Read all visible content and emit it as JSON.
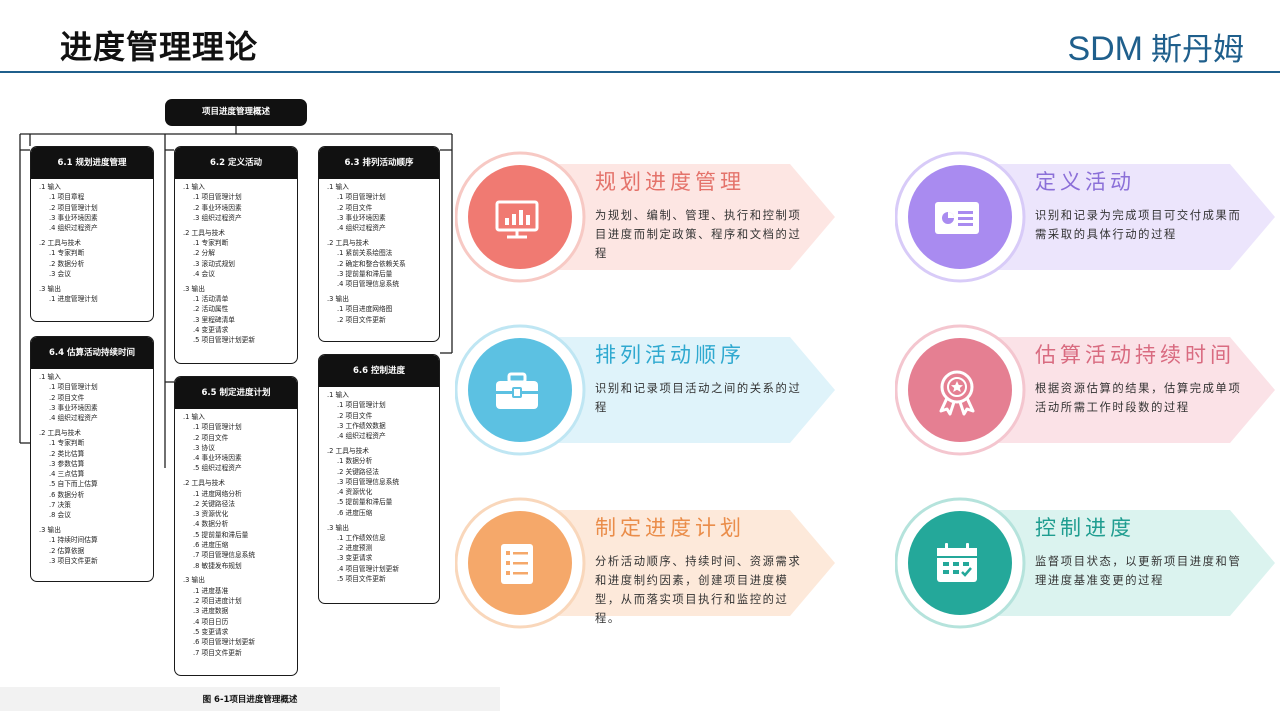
{
  "header": {
    "title": "进度管理理论",
    "brand_en": "SDM",
    "brand_cn": "斯丹姆"
  },
  "diagram": {
    "top_label": "项目进度管理概述",
    "caption": "图 6-1项目进度管理概述",
    "processes": [
      {
        "title": "6.1 规划进度管理",
        "groups": [
          {
            "heading": ".1 输入",
            "items": [
              ".1 项目章程",
              ".2 项目管理计划",
              ".3 事业环境因素",
              ".4 组织过程资产"
            ]
          },
          {
            "heading": ".2 工具与技术",
            "items": [
              ".1 专家判断",
              ".2 数据分析",
              ".3 会议"
            ]
          },
          {
            "heading": ".3 输出",
            "items": [
              ".1 进度管理计划"
            ]
          }
        ]
      },
      {
        "title": "6.2 定义活动",
        "groups": [
          {
            "heading": ".1 输入",
            "items": [
              ".1 项目管理计划",
              ".2 事业环境因素",
              ".3 组织过程资产"
            ]
          },
          {
            "heading": ".2 工具与技术",
            "items": [
              ".1 专家判断",
              ".2 分解",
              ".3 滚动式规划",
              ".4 会议"
            ]
          },
          {
            "heading": ".3 输出",
            "items": [
              ".1 活动清单",
              ".2 活动属性",
              ".3 里程碑清单",
              ".4 变更请求",
              ".5 项目管理计划更新"
            ]
          }
        ]
      },
      {
        "title": "6.3 排列活动顺序",
        "groups": [
          {
            "heading": ".1 输入",
            "items": [
              ".1 项目管理计划",
              ".2 项目文件",
              ".3 事业环境因素",
              ".4 组织过程资产"
            ]
          },
          {
            "heading": ".2 工具与技术",
            "items": [
              ".1 紧前关系绘图法",
              ".2 确定和整合依赖关系",
              ".3 提前量和滞后量",
              ".4 项目管理信息系统"
            ]
          },
          {
            "heading": ".3 输出",
            "items": [
              ".1 项目进度网络图",
              ".2 项目文件更新"
            ]
          }
        ]
      },
      {
        "title": "6.4 估算活动持续时间",
        "groups": [
          {
            "heading": ".1 输入",
            "items": [
              ".1 项目管理计划",
              ".2 项目文件",
              ".3 事业环境因素",
              ".4 组织过程资产"
            ]
          },
          {
            "heading": ".2 工具与技术",
            "items": [
              ".1 专家判断",
              ".2 类比估算",
              ".3 参数估算",
              ".4 三点估算",
              ".5 自下而上估算",
              ".6 数据分析",
              ".7 决策",
              ".8 会议"
            ]
          },
          {
            "heading": ".3 输出",
            "items": [
              ".1 持续时间估算",
              ".2 估算依据",
              ".3 项目文件更新"
            ]
          }
        ]
      },
      {
        "title": "6.5 制定进度计划",
        "groups": [
          {
            "heading": ".1 输入",
            "items": [
              ".1 项目管理计划",
              ".2 项目文件",
              ".3 协议",
              ".4 事业环境因素",
              ".5 组织过程资产"
            ]
          },
          {
            "heading": ".2 工具与技术",
            "items": [
              ".1 进度网络分析",
              ".2 关键路径法",
              ".3 资源优化",
              ".4 数据分析",
              ".5 提前量和滞后量",
              ".6 进度压缩",
              ".7 项目管理信息系统",
              ".8 敏捷发布规划"
            ]
          },
          {
            "heading": ".3 输出",
            "items": [
              ".1 进度基准",
              ".2 项目进度计划",
              ".3 进度数据",
              ".4 项目日历",
              ".5 变更请求",
              ".6 项目管理计划更新",
              ".7 项目文件更新"
            ]
          }
        ]
      },
      {
        "title": "6.6 控制进度",
        "groups": [
          {
            "heading": ".1 输入",
            "items": [
              ".1 项目管理计划",
              ".2 项目文件",
              ".3 工作绩效数据",
              ".4 组织过程资产"
            ]
          },
          {
            "heading": ".2 工具与技术",
            "items": [
              ".1 数据分析",
              ".2 关键路径法",
              ".3 项目管理信息系统",
              ".4 资源优化",
              ".5 提前量和滞后量",
              ".6 进度压缩"
            ]
          },
          {
            "heading": ".3 输出",
            "items": [
              ".1 工作绩效信息",
              ".2 进度预测",
              ".3 变更请求",
              ".4 项目管理计划更新",
              ".5 项目文件更新"
            ]
          }
        ]
      }
    ]
  },
  "cards": [
    {
      "title": "规划进度管理",
      "desc": "为规划、编制、管理、执行和控制项目进度而制定政策、程序和文档的过程",
      "icon": "chart-monitor-icon",
      "accent": "#f07a72",
      "ring": "#f7c9c4",
      "band": "#fde6e3",
      "title_color": "#e4726a"
    },
    {
      "title": "定义活动",
      "desc": "识别和记录为完成项目可交付成果而需采取的具体行动的过程",
      "icon": "id-card-icon",
      "accent": "#a98bf0",
      "ring": "#d8cbf8",
      "band": "#ece5fc",
      "title_color": "#8b6fd8"
    },
    {
      "title": "排列活动顺序",
      "desc": "识别和记录项目活动之间的关系的过程",
      "icon": "briefcase-icon",
      "accent": "#5cc1e2",
      "ring": "#bfe6f3",
      "band": "#dff3fa",
      "title_color": "#2fa9d0"
    },
    {
      "title": "估算活动持续时间",
      "desc": "根据资源估算的结果，估算完成单项活动所需工作时段数的过程",
      "icon": "award-badge-icon",
      "accent": "#e57f92",
      "ring": "#f4c6cf",
      "band": "#fbe2e7",
      "title_color": "#d96b80"
    },
    {
      "title": "制定进度计划",
      "desc": "分析活动顺序、持续时间、资源需求和进度制约因素，创建项目进度模型，从而落实项目执行和监控的过程。",
      "icon": "checklist-icon",
      "accent": "#f5a86a",
      "ring": "#f9d7bb",
      "band": "#fde9da",
      "title_color": "#ea8d4a"
    },
    {
      "title": "控制进度",
      "desc": "监督项目状态，以更新项目进度和管理进度基准变更的过程",
      "icon": "calendar-icon",
      "accent": "#24a89a",
      "ring": "#b5e3dc",
      "band": "#dbf3ef",
      "title_color": "#1f9d90"
    }
  ]
}
